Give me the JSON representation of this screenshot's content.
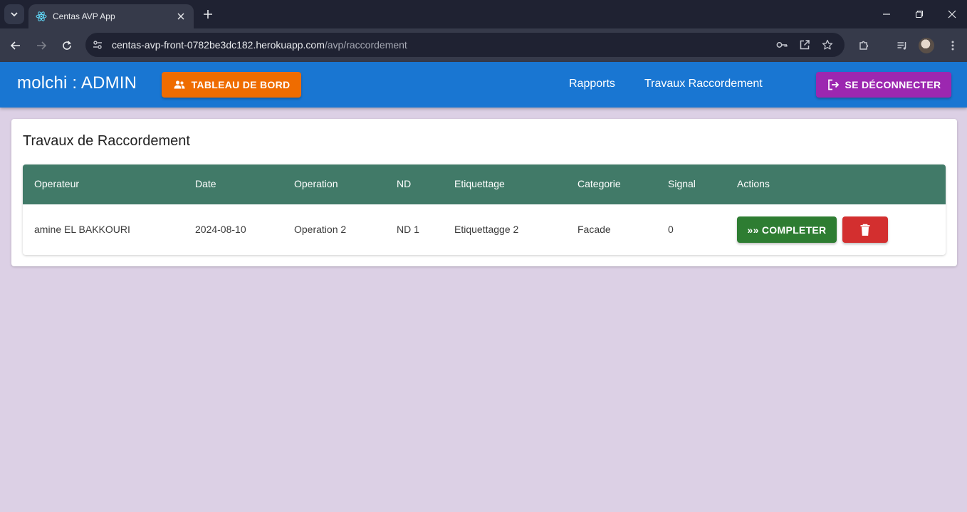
{
  "browser": {
    "tab_title": "Centas AVP App",
    "url_host": "centas-avp-front-0782be3dc182.herokuapp.com",
    "url_path": "/avp/raccordement"
  },
  "header": {
    "brand": "molchi : ADMIN",
    "dashboard_label": "TABLEAU DE BORD",
    "nav": [
      "Rapports",
      "Travaux Raccordement"
    ],
    "logout_label": "SE DÉCONNECTER"
  },
  "card": {
    "title": "Travaux de Raccordement"
  },
  "table": {
    "columns": [
      "Operateur",
      "Date",
      "Operation",
      "ND",
      "Etiquettage",
      "Categorie",
      "Signal",
      "Actions"
    ],
    "rows": [
      {
        "operateur": "amine EL BAKKOURI",
        "date": "2024-08-10",
        "operation": "Operation 2",
        "nd": "ND 1",
        "etiquettage": "Etiquettagge 2",
        "categorie": "Facade",
        "signal": "0",
        "complete_label": "»» COMPLETER"
      }
    ]
  },
  "colors": {
    "appbar": "#1976d2",
    "dashboard_button": "#ef6c00",
    "logout_button": "#9c27b0",
    "table_header": "#417a68",
    "complete_button": "#2e7d32",
    "delete_button": "#d32f2f",
    "page_background": "#dcd0e5"
  },
  "icons": {
    "dashboard": "people-icon",
    "logout": "logout-icon",
    "delete": "trash-icon"
  }
}
